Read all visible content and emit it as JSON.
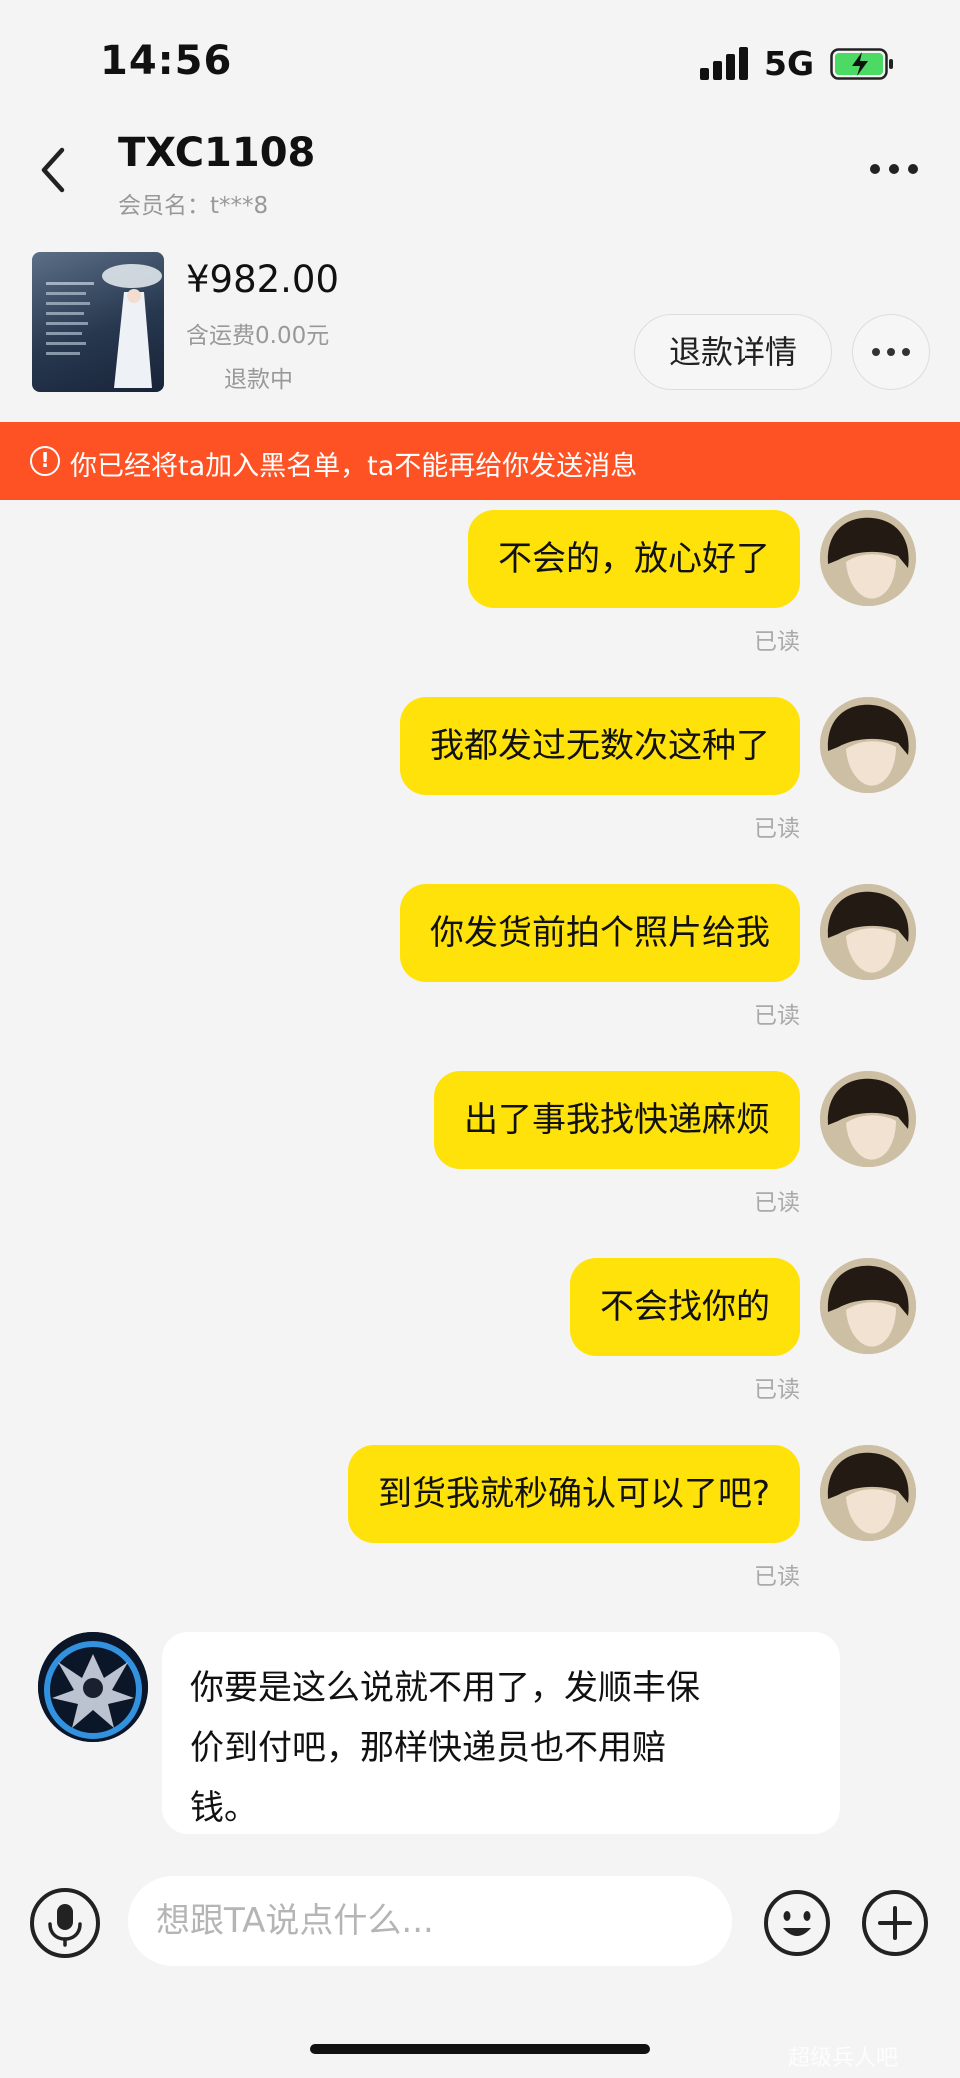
{
  "status_bar": {
    "time": "14:56",
    "network": "5G"
  },
  "header": {
    "title": "TXC1108",
    "member_label": "会员名：t***8"
  },
  "order": {
    "price": "¥982.00",
    "shipping": "含运费0.00元",
    "status": "退款中",
    "refund_detail_label": "退款详情"
  },
  "banner": {
    "icon_glyph": "!",
    "text": "你已经将ta加入黑名单，ta不能再给你发送消息"
  },
  "messages": [
    {
      "text": "不会的，放心好了",
      "status": "已读"
    },
    {
      "text": "我都发过无数次这种了",
      "status": "已读"
    },
    {
      "text": "你发货前拍个照片给我",
      "status": "已读"
    },
    {
      "text": "出了事我找快递麻烦",
      "status": "已读"
    },
    {
      "text": "不会找你的",
      "status": "已读"
    },
    {
      "text": "到货我就秒确认可以了吧?",
      "status": "已读"
    }
  ],
  "incoming_message": {
    "lines": [
      "你要是这么说就不用了，发顺丰保",
      "价到付吧，那样快递员也不用赔",
      "钱。"
    ]
  },
  "input": {
    "placeholder": "想跟TA说点什么..."
  },
  "watermark": "超级兵人吧",
  "colors": {
    "accent_yellow": "#ffe20a",
    "banner_red": "#ff5224",
    "background": "#f4f4f4"
  },
  "icons": {
    "back": "chevron-left-icon",
    "more": "more-dots-icon",
    "signal": "signal-icon",
    "battery": "battery-charging-icon",
    "warning": "warning-circle-icon",
    "voice": "microphone-icon",
    "emoji": "emoji-icon",
    "plus": "plus-icon"
  }
}
